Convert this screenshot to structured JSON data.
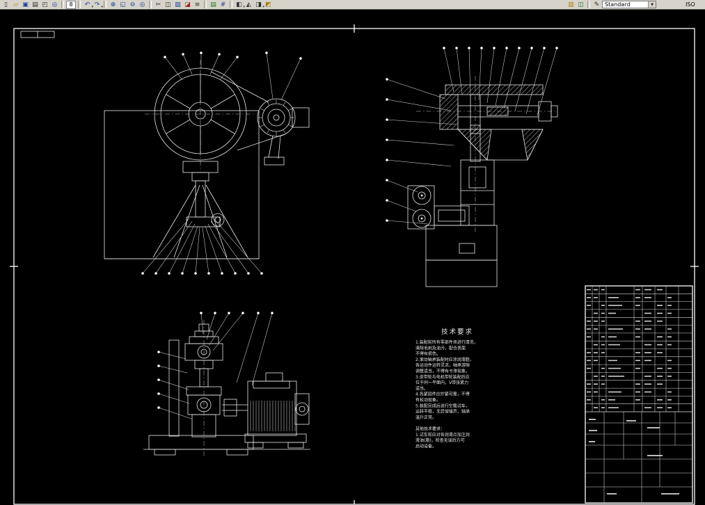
{
  "toolbar": {
    "items": [
      {
        "t": "icon",
        "name": "new-file",
        "g": "▯",
        "c": "k"
      },
      {
        "t": "icon",
        "name": "open-file",
        "g": "▱",
        "c": "y"
      },
      {
        "t": "icon",
        "name": "save-file",
        "g": "▣",
        "c": "b"
      },
      {
        "t": "icon",
        "name": "print",
        "g": "▤",
        "c": "k"
      },
      {
        "t": "icon",
        "name": "print-preview",
        "g": "◰",
        "c": "k"
      },
      {
        "t": "icon",
        "name": "find",
        "g": "◎",
        "c": "b"
      },
      {
        "t": "sep"
      },
      {
        "t": "field",
        "name": "zone-field",
        "value": "8"
      },
      {
        "t": "sep"
      },
      {
        "t": "icon",
        "name": "undo",
        "g": "↶",
        "c": "b",
        "dd": true
      },
      {
        "t": "icon",
        "name": "redo",
        "g": "↷",
        "c": "b",
        "dd": true
      },
      {
        "t": "sep"
      },
      {
        "t": "icon",
        "name": "zoom-realtime",
        "g": "⊕",
        "c": "b"
      },
      {
        "t": "icon",
        "name": "zoom-window",
        "g": "◱",
        "c": "b"
      },
      {
        "t": "icon",
        "name": "zoom-previous",
        "g": "⊖",
        "c": "b"
      },
      {
        "t": "icon",
        "name": "zoom-extents",
        "g": "◎",
        "c": "b"
      },
      {
        "t": "sep"
      },
      {
        "t": "icon",
        "name": "cut",
        "g": "✂",
        "c": "k"
      },
      {
        "t": "icon",
        "name": "copy",
        "g": "◫",
        "c": "k"
      },
      {
        "t": "icon",
        "name": "paste",
        "g": "▨",
        "c": "b"
      },
      {
        "t": "icon",
        "name": "erase",
        "g": "◪",
        "c": "r"
      },
      {
        "t": "icon",
        "name": "layers",
        "g": "≡",
        "c": "k"
      },
      {
        "t": "sep"
      },
      {
        "t": "icon",
        "name": "insert-table",
        "g": "▤",
        "c": "g"
      },
      {
        "t": "icon",
        "name": "calculator",
        "g": "#",
        "c": "b"
      },
      {
        "t": "sep"
      },
      {
        "t": "icon",
        "name": "named-views",
        "g": "◧",
        "c": "k",
        "dd": true
      },
      {
        "t": "icon",
        "name": "orbit",
        "g": "◭",
        "c": "k"
      },
      {
        "t": "icon",
        "name": "visual-styles",
        "g": "◨",
        "c": "k",
        "dd": true
      },
      {
        "t": "icon",
        "name": "render",
        "g": "◩",
        "c": "y"
      },
      {
        "t": "gap"
      },
      {
        "t": "icon",
        "name": "tool-palettes",
        "g": "▥",
        "c": "y"
      },
      {
        "t": "icon",
        "name": "properties",
        "g": "◫",
        "c": "g"
      },
      {
        "t": "sep"
      },
      {
        "t": "icon",
        "name": "markup",
        "g": "✎",
        "c": "k"
      },
      {
        "t": "combo",
        "name": "text-style-combo",
        "value": "Standard"
      },
      {
        "t": "sp"
      },
      {
        "t": "label",
        "name": "dim-style-label",
        "value": "ISO"
      }
    ]
  },
  "drawing": {
    "tech_requirements": {
      "title": "技术要求",
      "lines": [
        "1.装配前所有零部件须进行清洗，",
        "清除毛刺及油污，配合表面",
        "不得有损伤。",
        "2.滚动轴承装配时应涂润滑脂，",
        "各运动件运转灵活，轴承游隙",
        "调整适当，不得有卡滞现象。",
        "3.皮带轮与电机带轮装配后应",
        "位于同一平面内，V带张紧力",
        "适当。",
        "4.各紧固件应拧紧可靠，不得",
        "有松动现象。",
        "5.装配完成后进行空载试车，",
        "运转平稳，无异常噪声，轴承",
        "温升正常。",
        "",
        "其他技术要求：",
        "1.试车前应对各润滑点加注润",
        "滑油(脂)，检查无误后方可",
        "启动设备。"
      ]
    }
  }
}
